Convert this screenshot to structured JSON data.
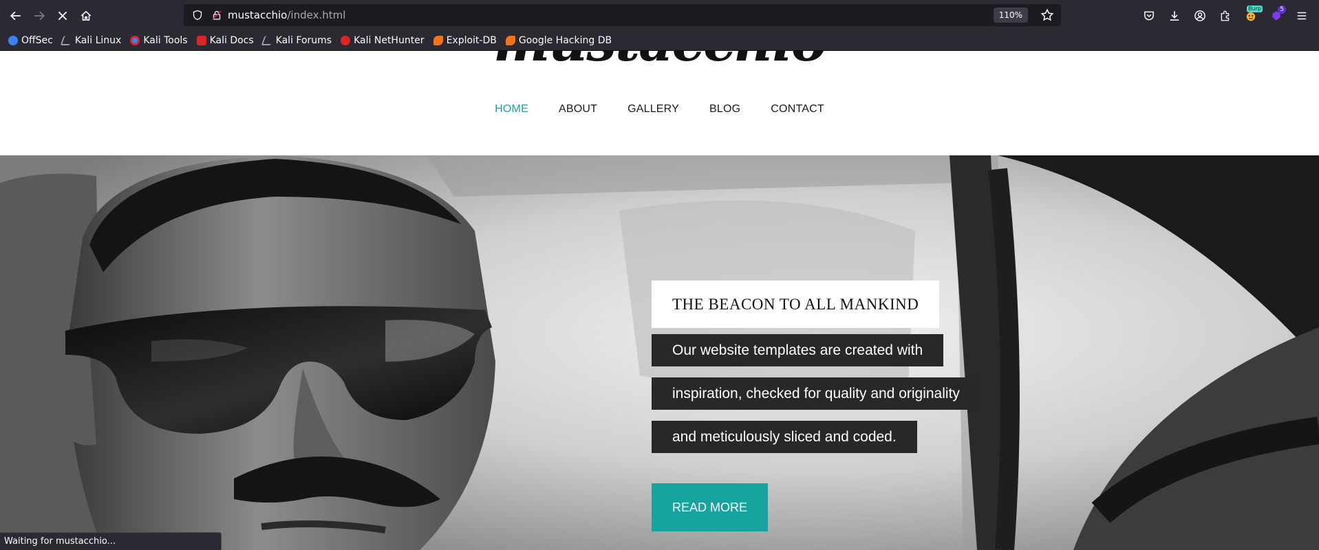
{
  "browser": {
    "url_host": "mustacchio",
    "url_path": "/index.html",
    "zoom": "110%",
    "extension_badge": "5",
    "burp_badge": "Burp",
    "status_text": "Waiting for mustacchio..."
  },
  "bookmarks": [
    {
      "label": "OffSec",
      "icon_color": "#3b82f6"
    },
    {
      "label": "Kali Linux",
      "icon_color": "#9ca3af"
    },
    {
      "label": "Kali Tools",
      "icon_color": "#3b82f6"
    },
    {
      "label": "Kali Docs",
      "icon_color": "#dc2626"
    },
    {
      "label": "Kali Forums",
      "icon_color": "#9ca3af"
    },
    {
      "label": "Kali NetHunter",
      "icon_color": "#dc2626"
    },
    {
      "label": "Exploit-DB",
      "icon_color": "#f97316"
    },
    {
      "label": "Google Hacking DB",
      "icon_color": "#f97316"
    }
  ],
  "site": {
    "logo_text": "mustacchio",
    "nav": [
      {
        "label": "HOME",
        "active": true
      },
      {
        "label": "ABOUT",
        "active": false
      },
      {
        "label": "GALLERY",
        "active": false
      },
      {
        "label": "BLOG",
        "active": false
      },
      {
        "label": "CONTACT",
        "active": false
      }
    ],
    "hero": {
      "headline": "THE BEACON TO ALL MANKIND",
      "lines": [
        "Our website templates are created with",
        "inspiration, checked for quality and originality",
        "and meticulously sliced and coded."
      ],
      "button_label": "READ MORE"
    }
  },
  "colors": {
    "accent": "#17a39f",
    "nav_active": "#1aa3a3",
    "chrome_bg": "#2b2a33",
    "caption_bg": "#282828"
  }
}
